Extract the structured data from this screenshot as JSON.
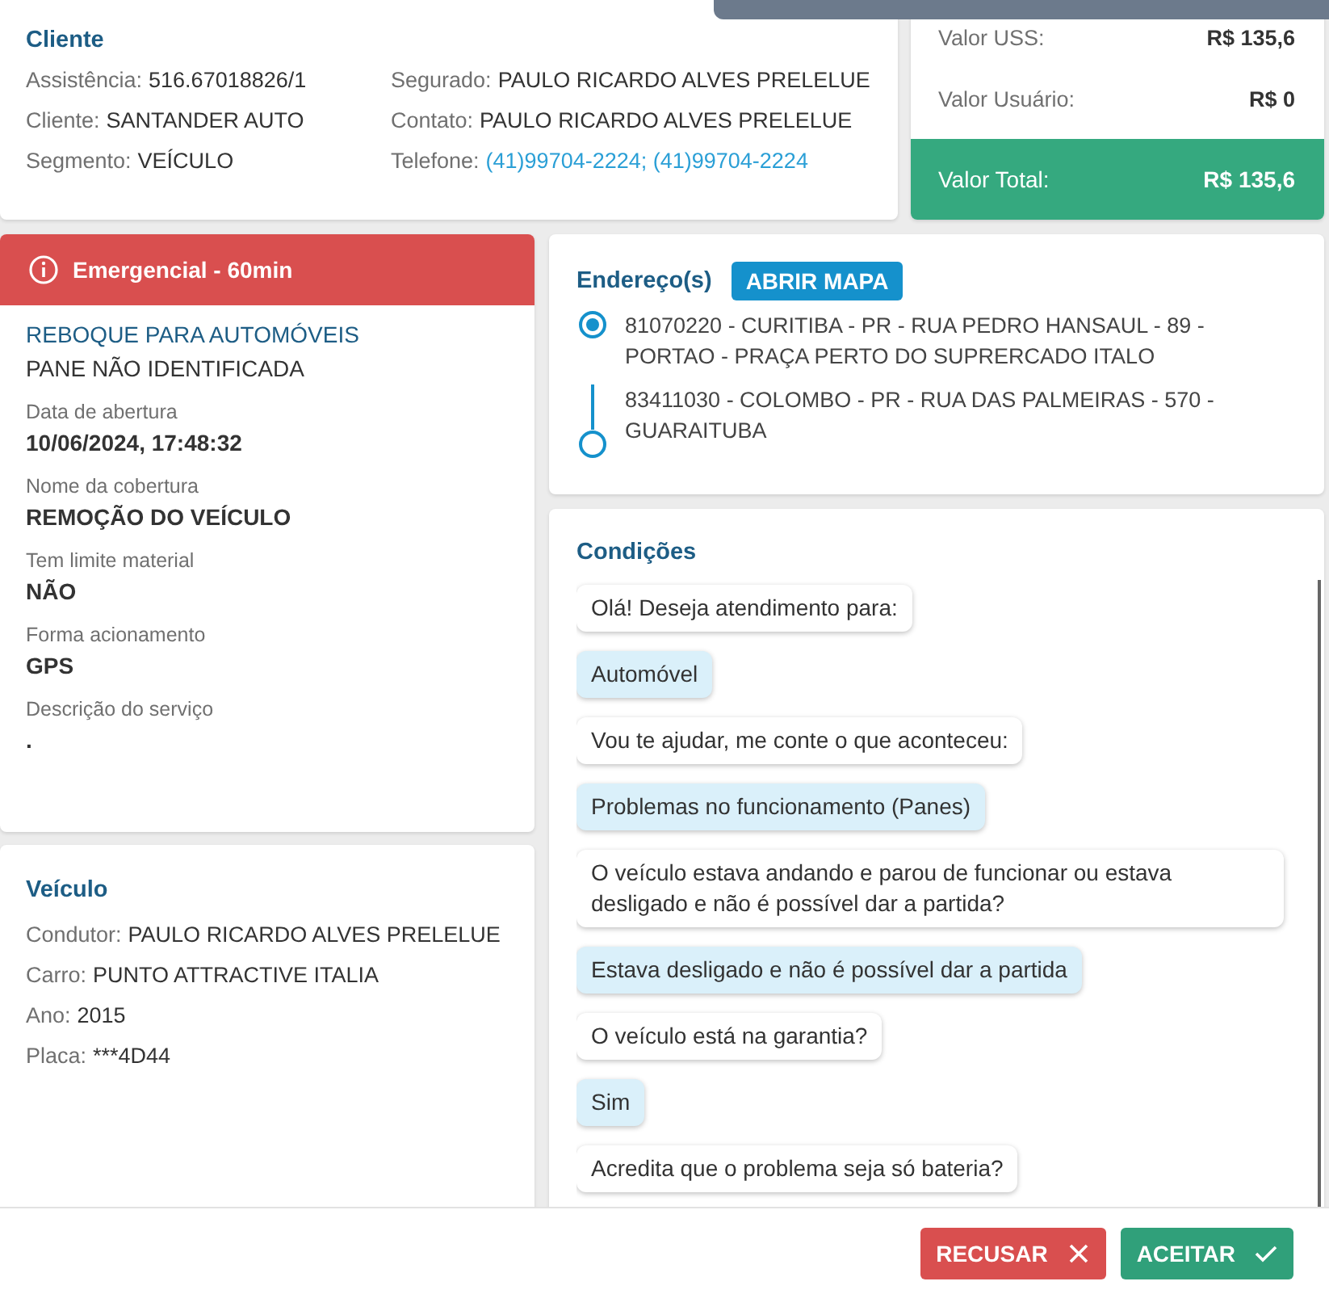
{
  "client": {
    "title": "Cliente",
    "columns": [
      [
        {
          "label": "Assistência:",
          "value": "516.67018826/1",
          "kind": "text"
        },
        {
          "label": "Cliente:",
          "value": "SANTANDER AUTO",
          "kind": "text"
        },
        {
          "label": "Segmento:",
          "value": "VEÍCULO",
          "kind": "text"
        }
      ],
      [
        {
          "label": "Segurado:",
          "value": "PAULO RICARDO ALVES PRELELUE",
          "kind": "text"
        },
        {
          "label": "Contato:",
          "value": "PAULO RICARDO ALVES PRELELUE",
          "kind": "text"
        },
        {
          "label": "Telefone:",
          "value": "(41)99704-2224; (41)99704-2224",
          "kind": "link"
        }
      ]
    ]
  },
  "values": {
    "rows": [
      {
        "label": "Valor USS:",
        "value": "R$ 135,6"
      },
      {
        "label": "Valor Usuário:",
        "value": "R$ 0"
      }
    ],
    "total": {
      "label": "Valor Total:",
      "value": "R$ 135,6"
    }
  },
  "service": {
    "badge": "Emergencial - 60min",
    "title": "REBOQUE PARA AUTOMÓVEIS",
    "subtitle": "PANE NÃO IDENTIFICADA",
    "fields": [
      {
        "label": "Data de abertura",
        "value": "10/06/2024, 17:48:32"
      },
      {
        "label": "Nome da cobertura",
        "value": "REMOÇÃO DO VEÍCULO"
      },
      {
        "label": "Tem limite material",
        "value": "NÃO"
      },
      {
        "label": "Forma acionamento",
        "value": "GPS"
      },
      {
        "label": "Descrição do serviço",
        "value": "."
      }
    ]
  },
  "vehicle": {
    "title": "Veículo",
    "fields": [
      {
        "label": "Condutor:",
        "value": "PAULO RICARDO ALVES PRELELUE"
      },
      {
        "label": "Carro:",
        "value": "PUNTO ATTRACTIVE ITALIA"
      },
      {
        "label": "Ano:",
        "value": "2015"
      },
      {
        "label": "Placa:",
        "value": "***4D44"
      }
    ]
  },
  "addresses": {
    "title": "Endereço(s)",
    "button": "ABRIR MAPA",
    "items": [
      {
        "kind": "origin",
        "text": "81070220 - CURITIBA - PR - RUA PEDRO HANSAUL - 89 - PORTAO - PRAÇA PERTO DO SUPRERCADO ITALO"
      },
      {
        "kind": "destination",
        "text": "83411030 - COLOMBO - PR - RUA DAS PALMEIRAS - 570 - GUARAITUBA"
      }
    ]
  },
  "conditions": {
    "title": "Condições",
    "messages": [
      {
        "kind": "question",
        "text": "Olá! Deseja atendimento para:"
      },
      {
        "kind": "answer",
        "text": "Automóvel"
      },
      {
        "kind": "question",
        "text": "Vou te ajudar, me conte o que aconteceu:"
      },
      {
        "kind": "answer",
        "text": "Problemas no funcionamento (Panes)"
      },
      {
        "kind": "question",
        "text": "O veículo estava andando e parou de funcionar ou estava desligado e não é possível dar a partida?"
      },
      {
        "kind": "answer",
        "text": "Estava desligado e não é possível dar a partida"
      },
      {
        "kind": "question",
        "text": "O veículo está na garantia?"
      },
      {
        "kind": "answer",
        "text": "Sim"
      },
      {
        "kind": "question",
        "text": "Acredita que o problema seja só bateria?"
      }
    ]
  },
  "actions": [
    {
      "kind": "reject",
      "label": "RECUSAR"
    },
    {
      "kind": "accept",
      "label": "ACEITAR"
    }
  ]
}
